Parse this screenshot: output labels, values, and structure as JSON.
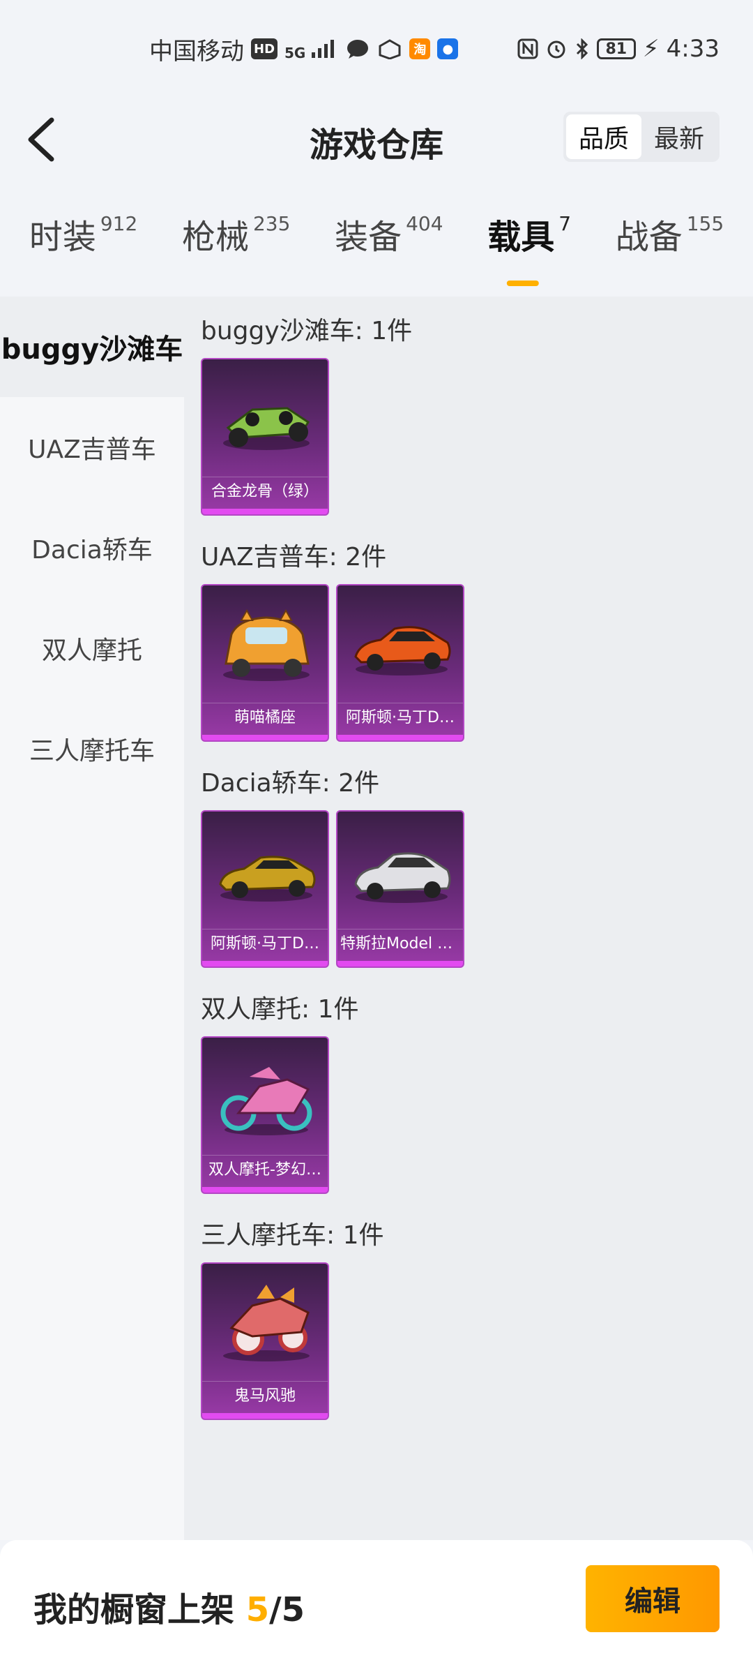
{
  "status_bar": {
    "carrier": "中国移动",
    "hd": "HD",
    "network": "5G",
    "battery": "81",
    "time": "4:33",
    "taobao_badge": "淘"
  },
  "header": {
    "title": "游戏仓库",
    "sort_options": [
      "品质",
      "最新"
    ],
    "active_sort": "品质"
  },
  "tabs": [
    {
      "label": "时装",
      "count": "912"
    },
    {
      "label": "枪械",
      "count": "235"
    },
    {
      "label": "装备",
      "count": "404"
    },
    {
      "label": "载具",
      "count": "7",
      "active": true
    },
    {
      "label": "战备",
      "count": "155"
    }
  ],
  "sidebar": {
    "items": [
      {
        "label": "buggy沙滩车",
        "active": true
      },
      {
        "label": "UAZ吉普车"
      },
      {
        "label": "Dacia轿车"
      },
      {
        "label": "双人摩托"
      },
      {
        "label": "三人摩托车"
      }
    ]
  },
  "sections": [
    {
      "title": "buggy沙滩车: 1件",
      "items": [
        {
          "name": "合金龙骨（绿）",
          "color": "#8bc34a"
        }
      ]
    },
    {
      "title": "UAZ吉普车: 2件",
      "items": [
        {
          "name": "萌喵橘座",
          "color": "#f0a030"
        },
        {
          "name": "阿斯顿·马丁D…",
          "color": "#e85a1a"
        }
      ]
    },
    {
      "title": "Dacia轿车: 2件",
      "items": [
        {
          "name": "阿斯顿·马丁D…",
          "color": "#c9a020"
        },
        {
          "name": "特斯拉Model 3…",
          "color": "#e0e0e4"
        }
      ]
    },
    {
      "title": "双人摩托: 1件",
      "items": [
        {
          "name": "双人摩托-梦幻…",
          "color": "#e87ab8"
        }
      ]
    },
    {
      "title": "三人摩托车: 1件",
      "items": [
        {
          "name": "鬼马风驰",
          "color": "#e06a6a"
        }
      ]
    }
  ],
  "bottom_bar": {
    "showcase_label": "我的橱窗上架",
    "showcase_current": "5",
    "showcase_total": "/5",
    "edit_label": "编辑"
  },
  "colors": {
    "accent": "#ffb000",
    "card_bg": "#6b2b7b",
    "card_border": "#e24bf0"
  }
}
